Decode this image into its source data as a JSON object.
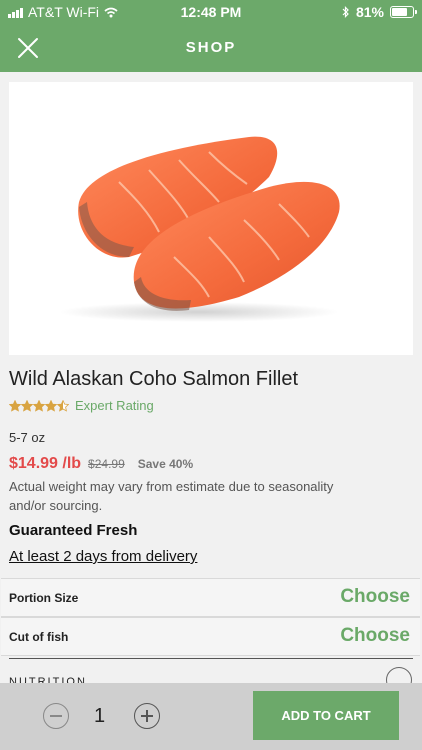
{
  "status_bar": {
    "carrier": "AT&T Wi-Fi",
    "time": "12:48 PM",
    "battery": "81%",
    "battery_level": 0.81,
    "icons": [
      "signal-bars-icon",
      "wifi-icon",
      "bluetooth-icon",
      "battery-icon"
    ]
  },
  "nav": {
    "title": "SHOP",
    "close_icon": "close-icon"
  },
  "product": {
    "name": "Wild Alaskan Coho Salmon Fillet",
    "rating_stars": 4.5,
    "rating_label": "Expert Rating",
    "size": "5-7 oz",
    "price": "$14.99 /lb",
    "old_price": "$24.99",
    "save": "Save 40%",
    "note": "Actual weight may vary from estimate due to seasonality and/or sourcing.",
    "guarantee": "Guaranteed Fresh",
    "delivery": "At least 2 days from delivery"
  },
  "options": [
    {
      "label": "Portion Size",
      "action": "Choose"
    },
    {
      "label": "Cut of fish",
      "action": "Choose"
    }
  ],
  "nutrition": {
    "label": "NUTRITION"
  },
  "cart": {
    "quantity": "1",
    "add_label": "ADD TO CART"
  },
  "colors": {
    "brand_green": "#6ca96a",
    "price_red": "#e34a4a",
    "star_gold": "#d9a441"
  }
}
